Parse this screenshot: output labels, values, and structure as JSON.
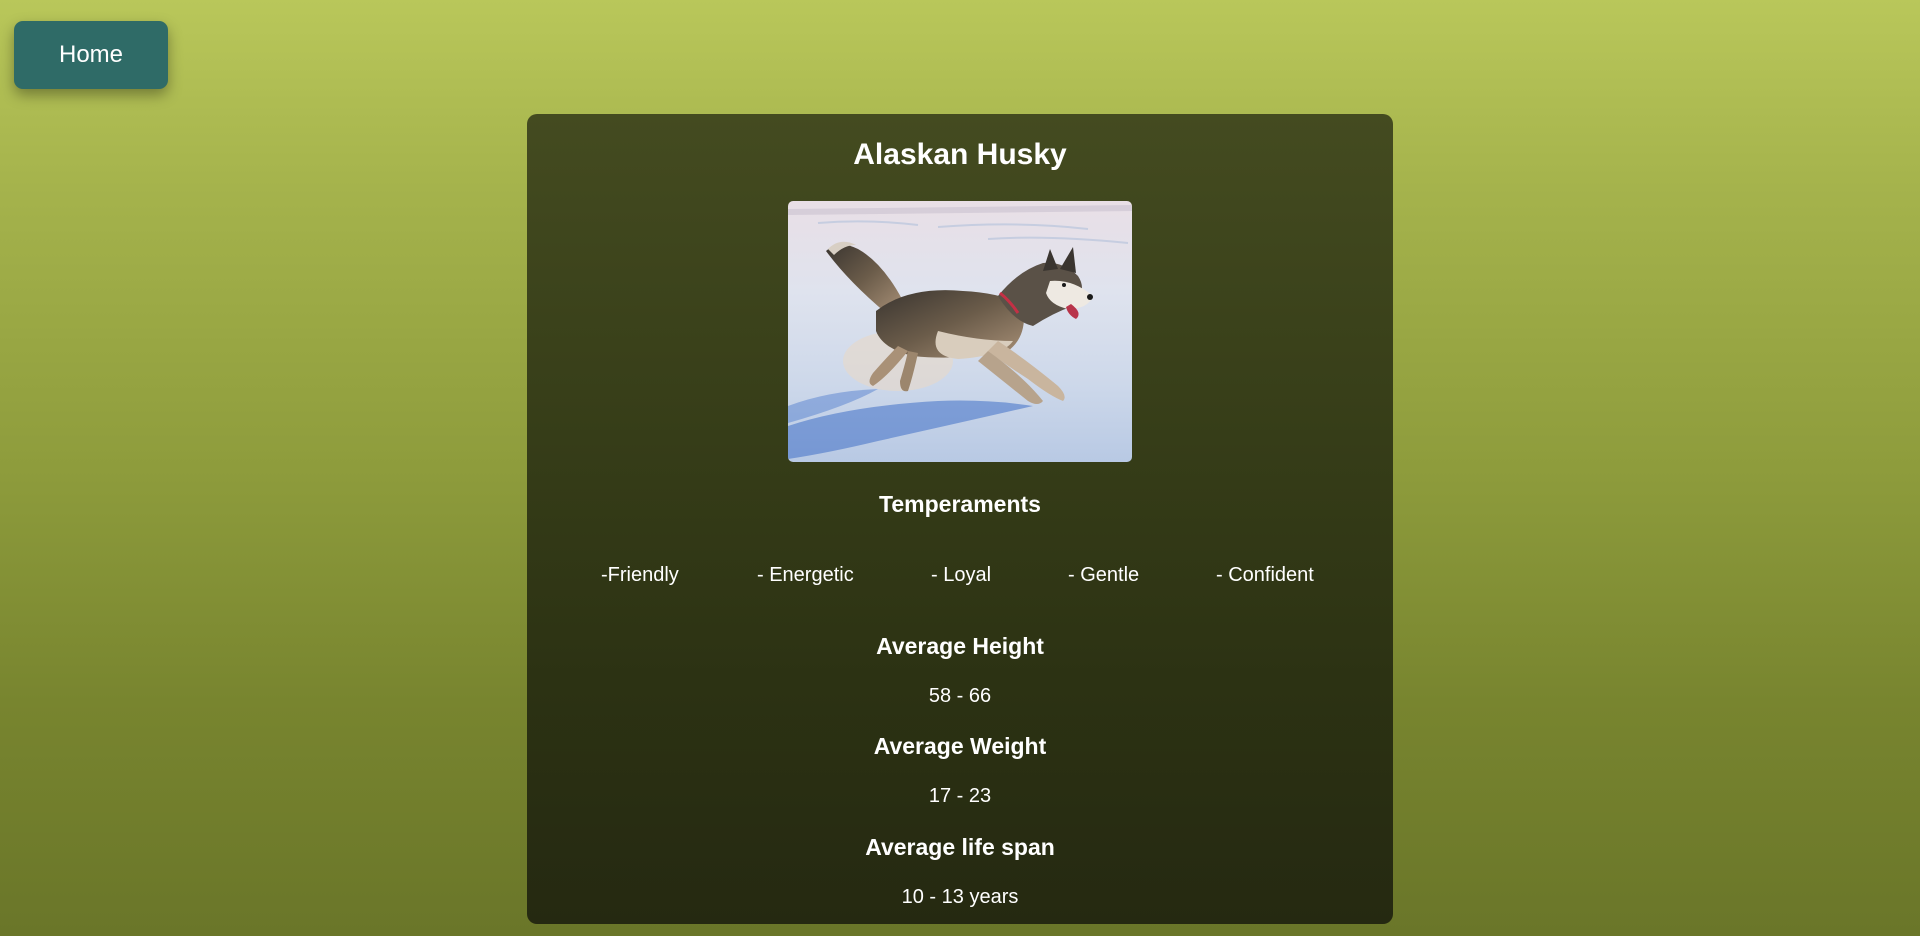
{
  "nav": {
    "home_label": "Home"
  },
  "breed": {
    "name": "Alaskan Husky",
    "image_alt": "Alaskan Husky running in snow"
  },
  "temperaments": {
    "heading": "Temperaments",
    "items": [
      "-Friendly",
      "- Energetic",
      "- Loyal",
      "- Gentle",
      "- Confident"
    ]
  },
  "height": {
    "heading": "Average Height",
    "value": "58 - 66"
  },
  "weight": {
    "heading": "Average Weight",
    "value": "17 - 23"
  },
  "life_span": {
    "heading": "Average life span",
    "value": "10 - 13 years"
  },
  "colors": {
    "home_button": "#2f6b67",
    "card_top": "#444b20",
    "card_bottom": "#252911",
    "page_top": "#b9c75a",
    "page_bottom": "#6a7629"
  }
}
